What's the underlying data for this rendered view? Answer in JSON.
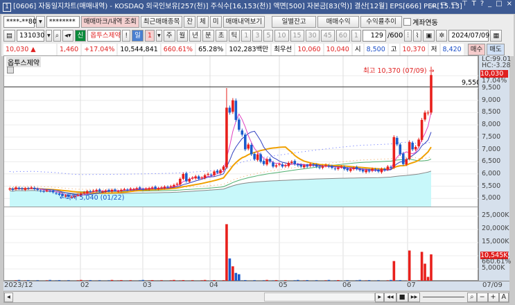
{
  "title": {
    "num": "1",
    "text": "[0606] 자동일지차트(매매내역) - KOSDAQ 외국인보유[257(천)] 주식수[16,153(천)] 액면[500] 자본금[83(억)] 결산[12월] EPS[666] PER[15.13]",
    "icons": [
      "ㅅ",
      "▭",
      "▭",
      "⊤",
      "T",
      "?",
      "_",
      "□",
      "×"
    ]
  },
  "row1": {
    "account": "****-**80",
    "password": "********",
    "btn_query": "매매마크/내역 조회",
    "btn_recent": "최근매매종목",
    "btn_jan": "잔",
    "btn_che": "체",
    "btn_mi": "미",
    "btn_view": "매매내역보기",
    "btn_daily": "일별잔고",
    "btn_profit": "매매수익",
    "btn_trend": "수익률추이",
    "link_label": "계좌연동"
  },
  "row2": {
    "code": "131030",
    "badge": "신",
    "name": "옵투스제약",
    "excl": "!",
    "day": "일",
    "period": "1",
    "units": [
      "주",
      "월",
      "년",
      "분",
      "초",
      "틱"
    ],
    "mins": [
      "1",
      "3",
      "5",
      "10",
      "15",
      "30",
      "45",
      "60"
    ],
    "min_sel": "1",
    "count": "129",
    "count_max": "/600",
    "date": "2024/07/09"
  },
  "row3": {
    "price": "10,030",
    "arrow": "▲",
    "change": "1,460",
    "pct": "+17.04%",
    "volume": "10,544,841",
    "vol_pct": "660.61%",
    "ratio": "65.28%",
    "amount": "102,283백만",
    "best": "최우선",
    "ask": "10,060",
    "bid": "10,040",
    "open_l": "시",
    "open": "8,500",
    "high_l": "고",
    "high": "10,370",
    "low_l": "저",
    "low": "8,420",
    "buy": "매수",
    "sell": "매도"
  },
  "chart": {
    "legend": "옵투스제약",
    "high_note": "최고 10,370 (07/09) →",
    "low_note": "←최저 5,040 (01/22)",
    "hline": "9,550",
    "lc": "LC:99.01",
    "hc": "HC:-3.28",
    "cur_price": "10,030",
    "cur_pct": "17.04%",
    "cur_vol": "10,545K",
    "cur_vol_pct": "660.61%",
    "price_ticks": [
      "9,500",
      "9,000",
      "8,500",
      "8,000",
      "7,500",
      "7,000",
      "6,500",
      "6,000",
      "5,500",
      "5,000"
    ],
    "vol_ticks": [
      "25,000K",
      "20,000K",
      "15,000K",
      "10,000K",
      "5,000K"
    ],
    "x_labels": [
      "2023/12",
      "02",
      "03",
      "04",
      "05",
      "06",
      "07"
    ],
    "last_date": "07/09"
  },
  "chart_data": {
    "type": "candlestick",
    "closes": [
      5400,
      5350,
      5450,
      5400,
      5380,
      5420,
      5400,
      5450,
      5380,
      5350,
      5300,
      5280,
      5320,
      5300,
      5250,
      5200,
      5150,
      5100,
      5120,
      5080,
      5060,
      5100,
      5150,
      5200,
      5250,
      5300,
      5280,
      5320,
      5350,
      5300,
      5280,
      5320,
      5300,
      5350,
      5320,
      5300,
      5350,
      5380,
      5350,
      5400,
      5380,
      5420,
      5400,
      5380,
      5400,
      5420,
      5450,
      5400,
      5420,
      5450,
      5480,
      5450,
      5500,
      5550,
      5600,
      5800,
      6000,
      5700,
      5800,
      5850,
      5900,
      5800,
      5850,
      5950,
      6000,
      5950,
      6100,
      6050,
      6150,
      6300,
      8700,
      8500,
      9000,
      8200,
      7800,
      7600,
      7000,
      7200,
      6800,
      6600,
      6800,
      6500,
      6400,
      6600,
      6500,
      6300,
      6350,
      6400,
      6300,
      6350,
      6450,
      6500,
      6400,
      6350,
      6300,
      6350,
      6300,
      6400,
      6350,
      6300,
      6250,
      6300,
      6350,
      6300,
      6250,
      6200,
      6250,
      6300,
      6200,
      6150,
      6200,
      6250,
      6200,
      6150,
      6100,
      6150,
      6100,
      6200,
      6150,
      6100,
      6200,
      6150,
      6300,
      6250,
      7500,
      7200,
      6800,
      6400,
      6600,
      7300,
      7000,
      7100,
      7400,
      8200,
      8500,
      8500,
      10030
    ],
    "volumes_k": {
      "default": 600,
      "spikes": {
        "70": 22000,
        "71": 9000,
        "72": 6000,
        "73": 3500,
        "74": 3000,
        "124": 8000,
        "129": 12000,
        "133": 11500,
        "134": 7000,
        "135": 2000,
        "136": 10545
      }
    },
    "last_high": 10370,
    "low_min": 5040,
    "price_range": [
      4800,
      10500
    ],
    "vol_range": [
      0,
      27000
    ]
  }
}
